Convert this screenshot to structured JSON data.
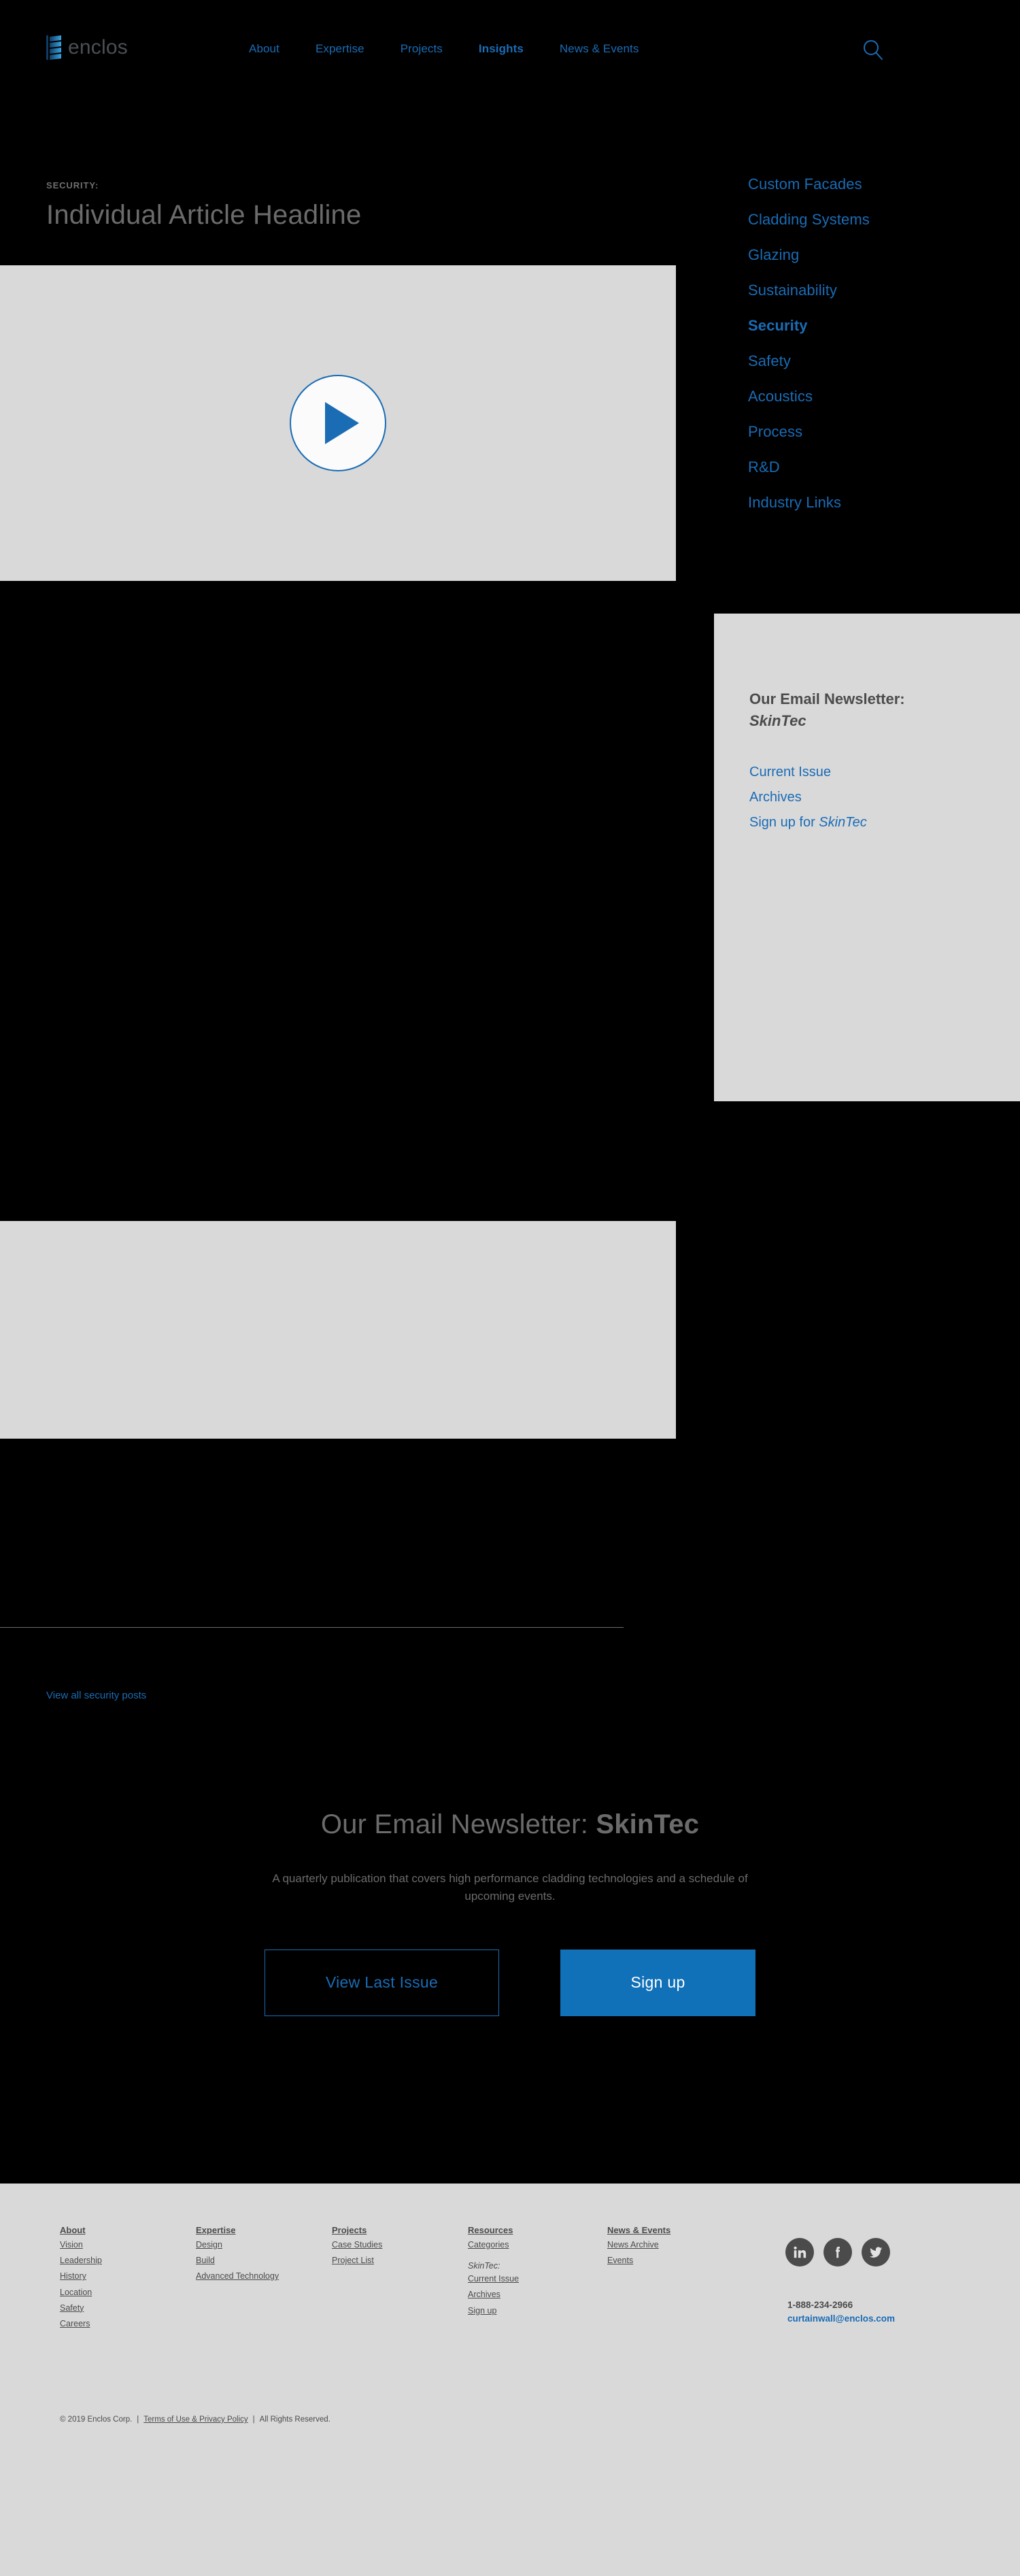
{
  "header": {
    "logo_text": "enclos",
    "logo_icon": "enclos-stripes-logo",
    "search_icon": "search-icon",
    "nav": [
      {
        "label": "About",
        "active": false
      },
      {
        "label": "Expertise",
        "active": false
      },
      {
        "label": "Projects",
        "active": false
      },
      {
        "label": "Insights",
        "active": true
      },
      {
        "label": "News & Events",
        "active": false
      }
    ]
  },
  "article": {
    "eyebrow": "SECURITY:",
    "title": "Individual Article Headline",
    "play_icon": "play-icon",
    "body_text": "",
    "view_all_label": "View all security posts"
  },
  "sidebar": {
    "categories": [
      {
        "label": "Custom Facades",
        "active": false
      },
      {
        "label": "Cladding Systems",
        "active": false
      },
      {
        "label": "Glazing",
        "active": false
      },
      {
        "label": "Sustainability",
        "active": false
      },
      {
        "label": "Security",
        "active": true
      },
      {
        "label": "Safety",
        "active": false
      },
      {
        "label": "Acoustics",
        "active": false
      },
      {
        "label": "Process",
        "active": false
      },
      {
        "label": "R&D",
        "active": false
      },
      {
        "label": "Industry Links",
        "active": false
      }
    ],
    "newsletter": {
      "title_line1": "Our Email Newsletter:",
      "brand": "SkinTec",
      "links": [
        {
          "label": "Current Issue",
          "emphasis": ""
        },
        {
          "label": "Archives",
          "emphasis": ""
        },
        {
          "label": "Sign up for ",
          "emphasis": "SkinTec"
        }
      ]
    }
  },
  "cta": {
    "title_prefix": "Our Email Newsletter: ",
    "title_brand": "SkinTec",
    "description": "A quarterly publication that covers high performance cladding technologies and a schedule of upcoming events.",
    "button_outline": "View Last Issue",
    "button_solid": "Sign up"
  },
  "footer": {
    "columns": [
      {
        "heading": "About",
        "links": [
          "Vision",
          "Leadership",
          "History",
          "Location",
          "Safety",
          "Careers"
        ]
      },
      {
        "heading": "Expertise",
        "links": [
          "Design",
          "Build",
          "Advanced Technology"
        ]
      },
      {
        "heading": "Projects",
        "links": [
          "Case Studies",
          "Project List"
        ]
      },
      {
        "heading": "Resources",
        "links": [
          "Categories"
        ],
        "sub_label": "SkinTec:",
        "sub_links": [
          "Current Issue",
          "Archives",
          "Sign up"
        ]
      },
      {
        "heading": "News & Events",
        "links": [
          "News Archive",
          "Events"
        ]
      }
    ],
    "social": [
      {
        "name": "linkedin-icon",
        "label": "LinkedIn"
      },
      {
        "name": "facebook-icon",
        "label": "Facebook"
      },
      {
        "name": "twitter-icon",
        "label": "Twitter"
      }
    ],
    "phone": "1-888-234-2966",
    "email": "curtainwall@enclos.com",
    "copyright": "© 2019 Enclos Corp.",
    "terms_label": "Terms of Use & Privacy Policy",
    "rights": "All Rights Reserved.",
    "separator": "|"
  },
  "colors": {
    "background": "#000000",
    "accent_blue": "#1a6cb5",
    "button_blue": "#1070b8",
    "placeholder_gray": "#d9d9d9",
    "text_gray": "#6b6b6b",
    "footer_text": "#4b4b4b"
  }
}
